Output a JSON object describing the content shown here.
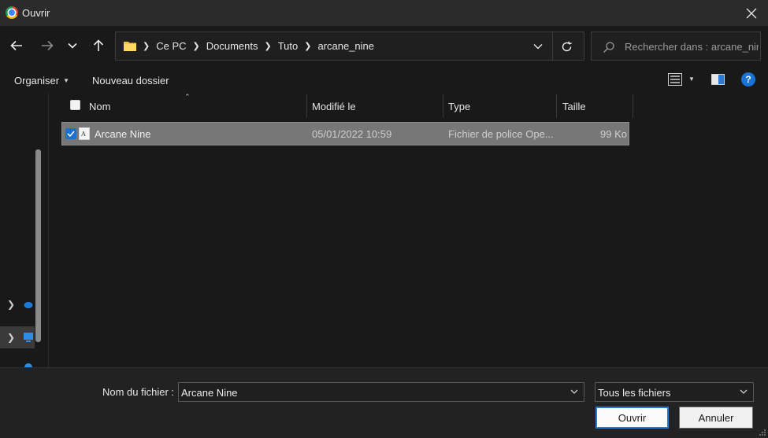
{
  "window": {
    "title": "Ouvrir",
    "close_label": "×"
  },
  "nav": {
    "breadcrumbs": [
      "Ce PC",
      "Documents",
      "Tuto",
      "arcane_nine"
    ],
    "search_placeholder": "Rechercher dans : arcane_nine"
  },
  "toolbar": {
    "organize_label": "Organiser",
    "new_folder_label": "Nouveau dossier",
    "help_label": "?"
  },
  "columns": {
    "name": "Nom",
    "modified": "Modifié le",
    "type": "Type",
    "size": "Taille"
  },
  "files": [
    {
      "name": "Arcane Nine",
      "modified": "05/01/2022 10:59",
      "type": "Fichier de police Ope...",
      "size": "99 Ko",
      "selected": true
    }
  ],
  "bottom": {
    "filename_label": "Nom du fichier :",
    "filename_value": "Arcane Nine",
    "filter_value": "Tous les fichiers",
    "open_label": "Ouvrir",
    "cancel_label": "Annuler"
  },
  "colors": {
    "accent": "#1f6fd0",
    "selection": "#777777",
    "background": "#191919",
    "titlebar": "#2b2b2b"
  },
  "icons": [
    "chrome-icon",
    "close-icon",
    "back-arrow-icon",
    "forward-arrow-icon",
    "chevron-down-icon",
    "up-arrow-icon",
    "folder-icon",
    "refresh-icon",
    "search-icon",
    "view-details-icon",
    "preview-pane-icon",
    "help-icon",
    "font-file-icon",
    "checkbox-checked-icon"
  ]
}
